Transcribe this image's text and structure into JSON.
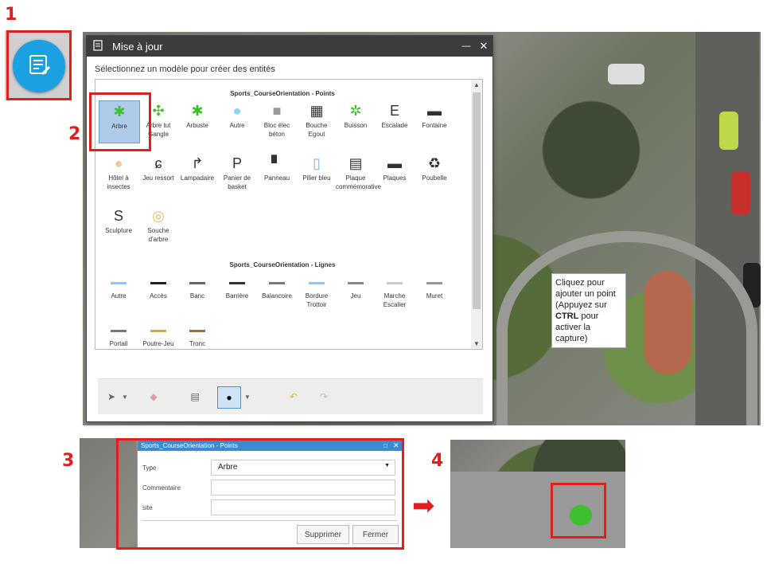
{
  "steps": [
    "1",
    "2",
    "3",
    "4"
  ],
  "dialog": {
    "title": "Mise à jour",
    "instruction": "Sélectionnez un modèle pour créer des entités",
    "minimize_glyph": "—",
    "close_glyph": "✕"
  },
  "sections": {
    "points_title": "Sports_CourseOrientation - Points",
    "lines_title": "Sports_CourseOrientation - Lignes"
  },
  "points": [
    {
      "label": "Arbre",
      "icon": "tree-green-icon",
      "selected": true
    },
    {
      "label": "Arbre tut Gangle",
      "icon": "tree-sprout-icon"
    },
    {
      "label": "Arbuste",
      "icon": "shrub-icon"
    },
    {
      "label": "Autre",
      "icon": "blue-circle-icon"
    },
    {
      "label": "Bloc élec béton",
      "icon": "gray-square-icon"
    },
    {
      "label": "Bouche Egout",
      "icon": "grate-icon"
    },
    {
      "label": "Buisson",
      "icon": "bush-icon"
    },
    {
      "label": "Escalade",
      "icon": "letter-e-icon"
    },
    {
      "label": "Fontaine",
      "icon": "fountain-icon"
    },
    {
      "label": "Hôtel à insectes",
      "icon": "beige-circle-icon"
    },
    {
      "label": "Jeu ressort",
      "icon": "spring-icon"
    },
    {
      "label": "Lampadaire",
      "icon": "lamp-icon"
    },
    {
      "label": "Panier de basket",
      "icon": "letter-p-icon"
    },
    {
      "label": "Panneau",
      "icon": "sign-icon"
    },
    {
      "label": "Pilier bleu",
      "icon": "blue-pillar-icon"
    },
    {
      "label": "Plaque commémorative",
      "icon": "plaque-icon"
    },
    {
      "label": "Plaques",
      "icon": "plaques-icon"
    },
    {
      "label": "Poubelle",
      "icon": "trash-icon"
    },
    {
      "label": "Sculpture",
      "icon": "letter-s-icon"
    },
    {
      "label": "Souche d'arbre",
      "icon": "stump-icon"
    }
  ],
  "point_glyphs": [
    "✱",
    "✣",
    "✱",
    "●",
    "■",
    "▦",
    "✲",
    "E",
    "▬",
    "●",
    "ɕ",
    "↱",
    "P",
    "▘",
    "▯",
    "▤",
    "▬",
    "♻",
    "S",
    "◎"
  ],
  "lines": [
    {
      "label": "Autre",
      "color": "#9cc3e6"
    },
    {
      "label": "Accès",
      "color": "#222222"
    },
    {
      "label": "Banc",
      "color": "#666666"
    },
    {
      "label": "Barrière",
      "color": "#333333"
    },
    {
      "label": "Balancoire",
      "color": "#777777"
    },
    {
      "label": "Bordure Trottoir",
      "color": "#9cc3e6"
    },
    {
      "label": "Jeu",
      "color": "#888888"
    },
    {
      "label": "Marche Escalier",
      "color": "#cccccc"
    },
    {
      "label": "Muret",
      "color": "#999999"
    },
    {
      "label": "Portail",
      "color": "#777777"
    },
    {
      "label": "Poutre-Jeu",
      "color": "#c8a86a"
    },
    {
      "label": "Tronc",
      "color": "#8a7440"
    }
  ],
  "tooltip": {
    "line1": "Cliquez pour ajouter un point",
    "line2a": "(Appuyez sur ",
    "line2b": "CTRL",
    "line2c": " pour activer la capture)"
  },
  "attribute_panel": {
    "title": "Sports_CourseOrientation - Points",
    "type_label": "Type",
    "type_value": "Arbre",
    "comment_label": "Commentaire",
    "comment_value": "",
    "site_label": "site",
    "site_value": "",
    "delete_button": "Supprimer",
    "close_button": "Fermer"
  },
  "arrow": "➡",
  "colors": {
    "accent": "#e01f1f",
    "title_bar": "#3c3c3c",
    "panel_title": "#3a8bd4",
    "tree": "#3fbf2f"
  }
}
